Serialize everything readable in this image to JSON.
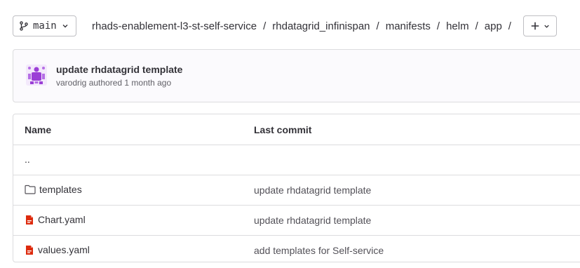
{
  "branch": {
    "name": "main",
    "icon": "branch-icon"
  },
  "breadcrumb": {
    "items": [
      "rhads-enablement-l3-st-self-service",
      "rhdatagrid_infinispan",
      "manifests",
      "helm",
      "app"
    ],
    "separator": "/"
  },
  "add_button": {
    "icon": "plus-icon"
  },
  "commit": {
    "title": "update rhdatagrid template",
    "author": "varodrig",
    "meta": "authored 1 month ago",
    "avatar_color": "#9b3fd6"
  },
  "table": {
    "headers": {
      "name": "Name",
      "last_commit": "Last commit"
    },
    "rows": [
      {
        "name": "..",
        "type": "parent",
        "last_commit": ""
      },
      {
        "name": "templates",
        "type": "folder",
        "last_commit": "update rhdatagrid template"
      },
      {
        "name": "Chart.yaml",
        "type": "yaml",
        "last_commit": "update rhdatagrid template"
      },
      {
        "name": "values.yaml",
        "type": "yaml",
        "last_commit": "add templates for Self-service"
      }
    ]
  },
  "colors": {
    "yaml_icon": "#dd2b0e",
    "border": "#dcdcde",
    "text": "#333238"
  }
}
